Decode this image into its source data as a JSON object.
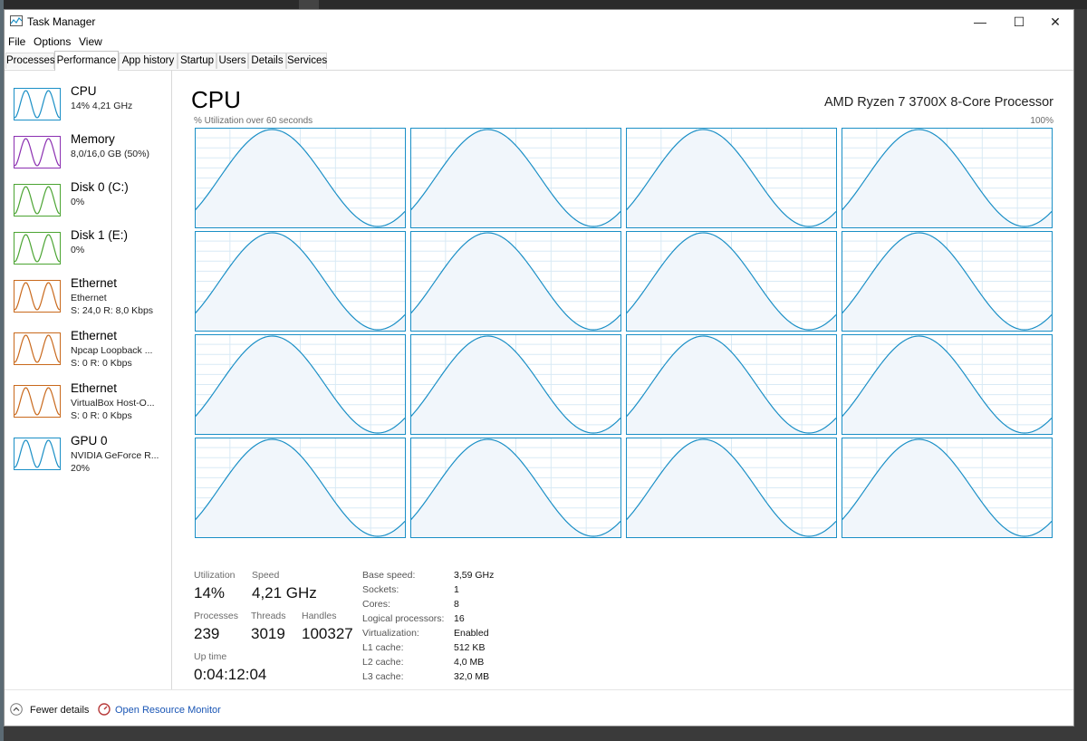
{
  "window": {
    "title": "Task Manager",
    "minimize_glyph": "—",
    "maximize_glyph": "☐",
    "close_glyph": "✕"
  },
  "menu": [
    "File",
    "Options",
    "View"
  ],
  "tabs": [
    {
      "label": "Processes",
      "active": false
    },
    {
      "label": "Performance",
      "active": true
    },
    {
      "label": "App history",
      "active": false
    },
    {
      "label": "Startup",
      "active": false
    },
    {
      "label": "Users",
      "active": false
    },
    {
      "label": "Details",
      "active": false
    },
    {
      "label": "Services",
      "active": false
    }
  ],
  "sidebar": {
    "items": [
      {
        "name": "CPU",
        "line1": "14% 4,21 GHz",
        "line2": "",
        "color": "#1a8fc6",
        "active": true
      },
      {
        "name": "Memory",
        "line1": "8,0/16,0 GB (50%)",
        "line2": "",
        "color": "#8b2fb1",
        "active": false
      },
      {
        "name": "Disk 0 (C:)",
        "line1": "0%",
        "line2": "",
        "color": "#4ba432",
        "active": false
      },
      {
        "name": "Disk 1 (E:)",
        "line1": "0%",
        "line2": "",
        "color": "#4ba432",
        "active": false
      },
      {
        "name": "Ethernet",
        "line1": "Ethernet",
        "line2": "S: 24,0 R: 8,0 Kbps",
        "color": "#c9691c",
        "active": false
      },
      {
        "name": "Ethernet",
        "line1": "Npcap Loopback ...",
        "line2": "S: 0 R: 0 Kbps",
        "color": "#c9691c",
        "active": false
      },
      {
        "name": "Ethernet",
        "line1": "VirtualBox Host-O...",
        "line2": "S: 0 R: 0 Kbps",
        "color": "#c9691c",
        "active": false
      },
      {
        "name": "GPU 0",
        "line1": "NVIDIA GeForce R...",
        "line2": "20%",
        "color": "#1a8fc6",
        "active": false
      }
    ]
  },
  "main": {
    "title": "CPU",
    "processor": "AMD Ryzen 7 3700X 8-Core Processor",
    "util_label": "% Utilization over 60 seconds",
    "util_max": "100%",
    "core_count": 16,
    "graph_color": "#1a8fc6",
    "graph_fill": "#f1f6fb"
  },
  "stats": {
    "utilization_label": "Utilization",
    "utilization": "14%",
    "speed_label": "Speed",
    "speed": "4,21 GHz",
    "processes_label": "Processes",
    "processes": "239",
    "threads_label": "Threads",
    "threads": "3019",
    "handles_label": "Handles",
    "handles": "100327",
    "uptime_label": "Up time",
    "uptime": "0:04:12:04",
    "details": [
      {
        "label": "Base speed:",
        "value": "3,59 GHz"
      },
      {
        "label": "Sockets:",
        "value": "1"
      },
      {
        "label": "Cores:",
        "value": "8"
      },
      {
        "label": "Logical processors:",
        "value": "16"
      },
      {
        "label": "Virtualization:",
        "value": "Enabled"
      },
      {
        "label": "L1 cache:",
        "value": "512 KB"
      },
      {
        "label": "L2 cache:",
        "value": "4,0 MB"
      },
      {
        "label": "L3 cache:",
        "value": "32,0 MB"
      }
    ]
  },
  "footer": {
    "fewer_details": "Fewer details",
    "resource_monitor": "Open Resource Monitor"
  }
}
